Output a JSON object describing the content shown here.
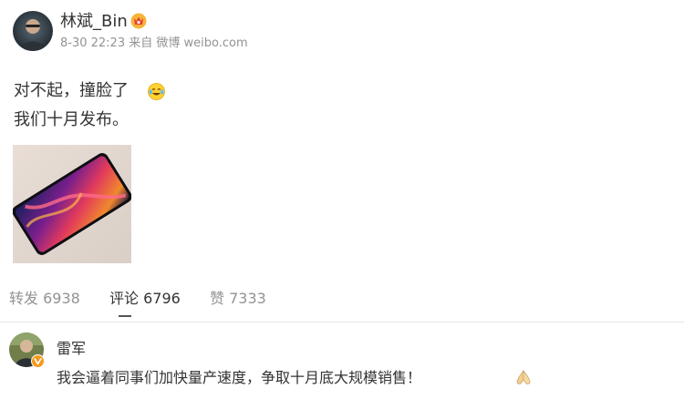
{
  "post": {
    "author": {
      "name": "林斌_Bin",
      "avatar": "avatar-photo",
      "badge": "vip-crown-icon"
    },
    "meta": "8-30 22:23 来自 微博 weibo.com",
    "text_lines": [
      "对不起，撞脸了",
      "我们十月发布。"
    ],
    "text_emoji": "laugh-cry-emoji",
    "image": "phone-photo"
  },
  "actions": {
    "repost": "转发 6938",
    "comment": "评论 6796",
    "like": "赞 7333",
    "active_tab": "comment"
  },
  "comment": {
    "author": "雷军",
    "verified_badge": "verified-v-icon",
    "text": "我会逼着同事们加快量产速度，争取十月底大规模销售！",
    "emoji": "praying-hands-emoji"
  },
  "colors": {
    "text_primary": "#333333",
    "text_secondary": "#939393",
    "divider": "#e6e6e6",
    "badge_orange": "#f49a1c"
  }
}
